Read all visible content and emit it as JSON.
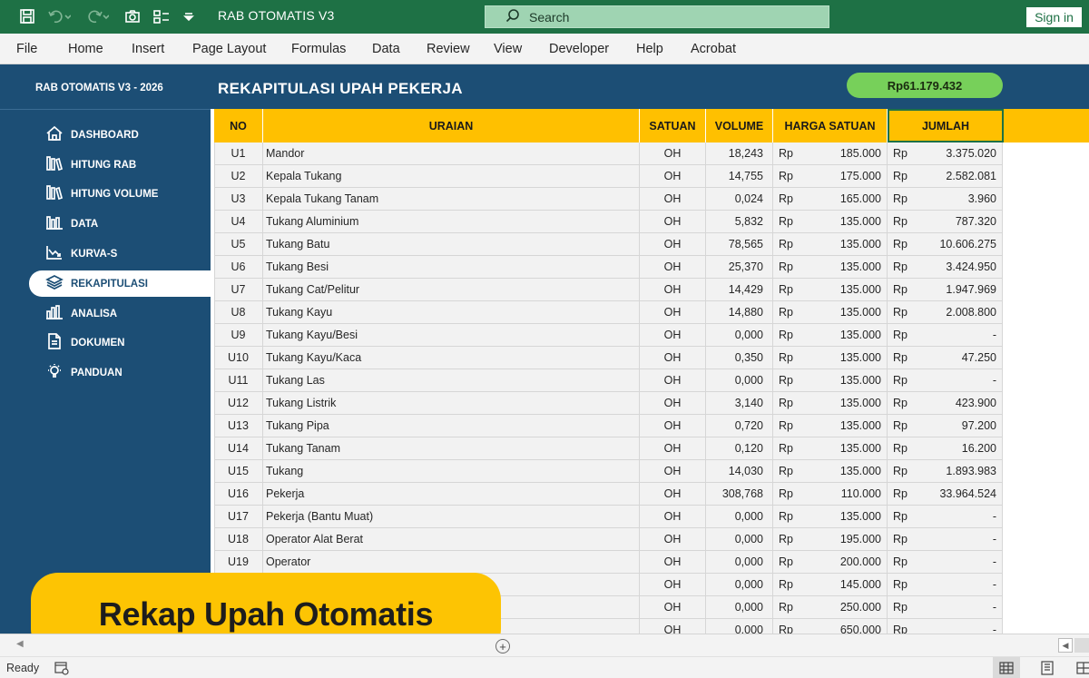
{
  "titlebar": {
    "doc_title": "RAB OTOMATIS V3",
    "search_placeholder": "Search",
    "signin_label": "Sign in"
  },
  "menu": [
    "File",
    "Home",
    "Insert",
    "Page Layout",
    "Formulas",
    "Data",
    "Review",
    "View",
    "Developer",
    "Help",
    "Acrobat"
  ],
  "sheet": {
    "brand": "RAB OTOMATIS V3 - 2026",
    "title": "REKAPITULASI UPAH PEKERJA",
    "total": "Rp61.179.432"
  },
  "sidebar": {
    "items": [
      {
        "label": "DASHBOARD",
        "icon": "home-icon",
        "active": false
      },
      {
        "label": "HITUNG RAB",
        "icon": "books-icon",
        "active": false
      },
      {
        "label": "HITUNG VOLUME",
        "icon": "books-icon",
        "active": false
      },
      {
        "label": "DATA",
        "icon": "bar-chart-icon",
        "active": false
      },
      {
        "label": "KURVA-S",
        "icon": "trend-icon",
        "active": false
      },
      {
        "label": "REKAPITULASI",
        "icon": "layers-icon",
        "active": true
      },
      {
        "label": "ANALISA",
        "icon": "analysis-icon",
        "active": false
      },
      {
        "label": "DOKUMEN",
        "icon": "document-icon",
        "active": false
      },
      {
        "label": "PANDUAN",
        "icon": "bulb-icon",
        "active": false
      }
    ]
  },
  "table": {
    "headers": [
      "NO",
      "URAIAN",
      "SATUAN",
      "VOLUME",
      "HARGA SATUAN",
      "JUMLAH"
    ],
    "currency": "Rp",
    "rows": [
      {
        "no": "U1",
        "uraian": "Mandor",
        "satuan": "OH",
        "volume": "18,243",
        "harga": "185.000",
        "jumlah": "3.375.020"
      },
      {
        "no": "U2",
        "uraian": "Kepala Tukang",
        "satuan": "OH",
        "volume": "14,755",
        "harga": "175.000",
        "jumlah": "2.582.081"
      },
      {
        "no": "U3",
        "uraian": "Kepala Tukang Tanam",
        "satuan": "OH",
        "volume": "0,024",
        "harga": "165.000",
        "jumlah": "3.960"
      },
      {
        "no": "U4",
        "uraian": "Tukang Aluminium",
        "satuan": "OH",
        "volume": "5,832",
        "harga": "135.000",
        "jumlah": "787.320"
      },
      {
        "no": "U5",
        "uraian": "Tukang Batu",
        "satuan": "OH",
        "volume": "78,565",
        "harga": "135.000",
        "jumlah": "10.606.275"
      },
      {
        "no": "U6",
        "uraian": "Tukang Besi",
        "satuan": "OH",
        "volume": "25,370",
        "harga": "135.000",
        "jumlah": "3.424.950"
      },
      {
        "no": "U7",
        "uraian": "Tukang Cat/Pelitur",
        "satuan": "OH",
        "volume": "14,429",
        "harga": "135.000",
        "jumlah": "1.947.969"
      },
      {
        "no": "U8",
        "uraian": "Tukang Kayu",
        "satuan": "OH",
        "volume": "14,880",
        "harga": "135.000",
        "jumlah": "2.008.800"
      },
      {
        "no": "U9",
        "uraian": "Tukang Kayu/Besi",
        "satuan": "OH",
        "volume": "0,000",
        "harga": "135.000",
        "jumlah": "-"
      },
      {
        "no": "U10",
        "uraian": "Tukang Kayu/Kaca",
        "satuan": "OH",
        "volume": "0,350",
        "harga": "135.000",
        "jumlah": "47.250"
      },
      {
        "no": "U11",
        "uraian": "Tukang Las",
        "satuan": "OH",
        "volume": "0,000",
        "harga": "135.000",
        "jumlah": "-"
      },
      {
        "no": "U12",
        "uraian": "Tukang Listrik",
        "satuan": "OH",
        "volume": "3,140",
        "harga": "135.000",
        "jumlah": "423.900"
      },
      {
        "no": "U13",
        "uraian": "Tukang Pipa",
        "satuan": "OH",
        "volume": "0,720",
        "harga": "135.000",
        "jumlah": "97.200"
      },
      {
        "no": "U14",
        "uraian": "Tukang Tanam",
        "satuan": "OH",
        "volume": "0,120",
        "harga": "135.000",
        "jumlah": "16.200"
      },
      {
        "no": "U15",
        "uraian": "Tukang",
        "satuan": "OH",
        "volume": "14,030",
        "harga": "135.000",
        "jumlah": "1.893.983"
      },
      {
        "no": "U16",
        "uraian": "Pekerja",
        "satuan": "OH",
        "volume": "308,768",
        "harga": "110.000",
        "jumlah": "33.964.524"
      },
      {
        "no": "U17",
        "uraian": "Pekerja (Bantu Muat)",
        "satuan": "OH",
        "volume": "0,000",
        "harga": "135.000",
        "jumlah": "-"
      },
      {
        "no": "U18",
        "uraian": "Operator Alat Berat",
        "satuan": "OH",
        "volume": "0,000",
        "harga": "195.000",
        "jumlah": "-"
      },
      {
        "no": "U19",
        "uraian": "Operator",
        "satuan": "OH",
        "volume": "0,000",
        "harga": "200.000",
        "jumlah": "-"
      },
      {
        "no": "",
        "uraian": "",
        "satuan": "OH",
        "volume": "0,000",
        "harga": "145.000",
        "jumlah": "-"
      },
      {
        "no": "",
        "uraian": "",
        "satuan": "OH",
        "volume": "0,000",
        "harga": "250.000",
        "jumlah": "-"
      },
      {
        "no": "",
        "uraian": "",
        "satuan": "OH",
        "volume": "0,000",
        "harga": "650.000",
        "jumlah": "-"
      }
    ]
  },
  "banner": "Rekap Upah Otomatis",
  "status": {
    "ready": "Ready"
  },
  "colors": {
    "excel_green": "#1e7145",
    "navy": "#1c4e75",
    "header_yellow": "#ffc000",
    "pill_green": "#77d05a",
    "banner_yellow": "#fdc403"
  }
}
